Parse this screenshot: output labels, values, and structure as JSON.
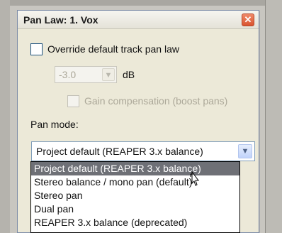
{
  "dialog": {
    "title": "Pan Law: 1. Vox",
    "close_glyph": "✕",
    "override_label": "Override default track pan law",
    "override_checked": false,
    "pan_law_value": "-3.0",
    "pan_law_unit": "dB",
    "gain_comp_label": "Gain compensation (boost pans)",
    "gain_comp_checked": false,
    "pan_mode_label": "Pan mode:",
    "pan_mode_selected": "Project default (REAPER 3.x balance)"
  },
  "dropdown": {
    "options": [
      "Project default (REAPER 3.x balance)",
      "Stereo balance / mono pan (default)",
      "Stereo pan",
      "Dual pan",
      "REAPER 3.x balance (deprecated)"
    ],
    "highlighted_index": 0
  },
  "icons": {
    "close": "close-icon",
    "dropdown_arrow": "chevron-down-icon",
    "cursor": "mouse-cursor-icon"
  },
  "colors": {
    "close_button": "#d9542f",
    "highlight": "#6e7076",
    "dialog_bg": "#ece9d8"
  }
}
